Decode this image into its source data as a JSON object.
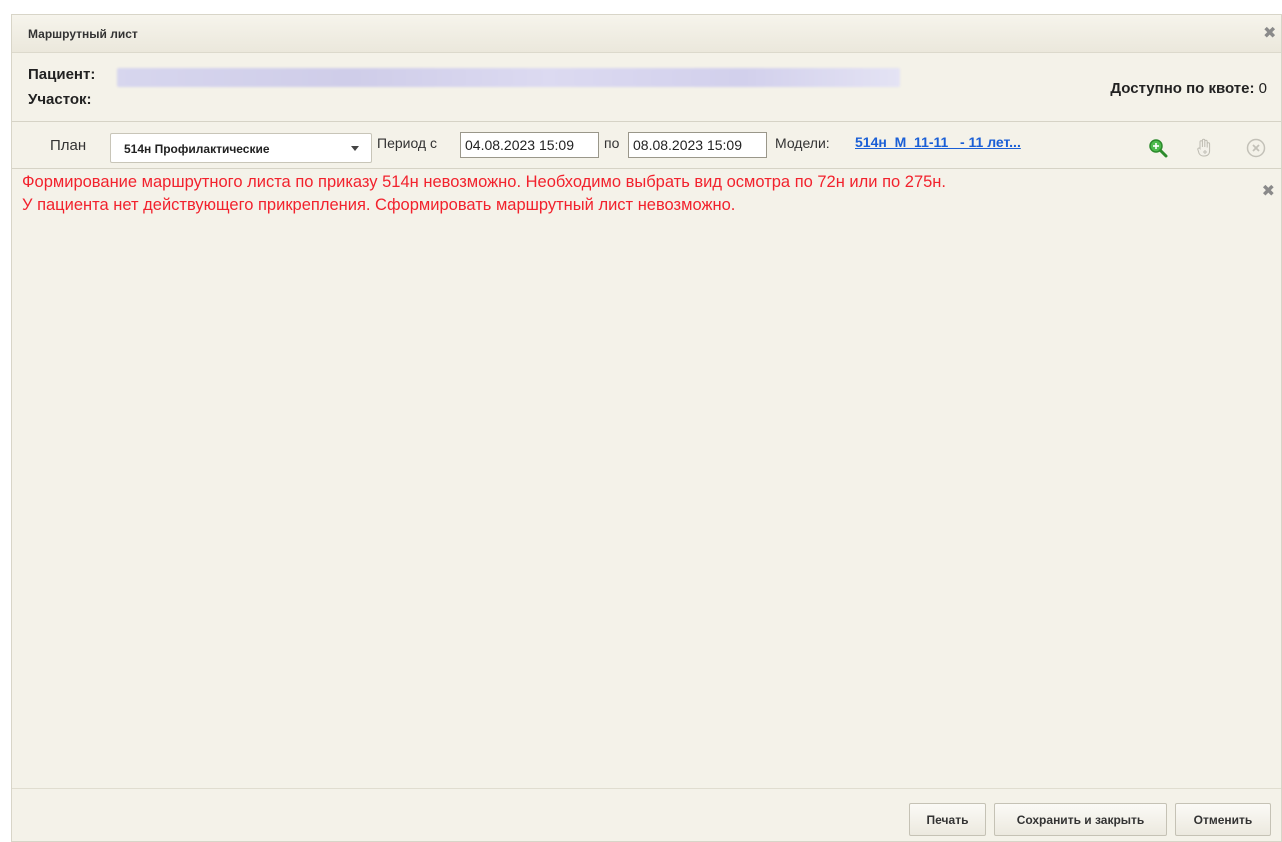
{
  "dialog": {
    "title": "Маршрутный лист"
  },
  "patient": {
    "patient_label": "Пациент:",
    "area_label": "Участок:",
    "quota_label": "Доступно по квоте:",
    "quota_value": "0"
  },
  "toolbar": {
    "plan_label": "План",
    "plan_value": "514н Профилактические",
    "period_label": "Период с",
    "date_from": "04.08.2023 15:09",
    "by_label": "по",
    "date_to": "08.08.2023 15:09",
    "models_label": "Модели:",
    "models_value": "514н_М_11-11_ - 11 лет..."
  },
  "errors": [
    "Формирование маршрутного листа по приказу 514н невозможно. Необходимо выбрать вид осмотра по 72н или по 275н.",
    "У пациента нет действующего прикрепления. Сформировать маршрутный лист невозможно."
  ],
  "footer": {
    "print_label": "Печать",
    "save_label": "Сохранить и закрыть",
    "cancel_label": "Отменить"
  },
  "colors": {
    "background": "#f4f2e9",
    "error": "#f2222d",
    "link": "#1a5fd6",
    "zoom_icon": "#3aa83a"
  },
  "icons": [
    "close-icon",
    "zoom-in-icon",
    "hand-add-icon",
    "clear-circle-icon",
    "chevron-down-icon"
  ]
}
